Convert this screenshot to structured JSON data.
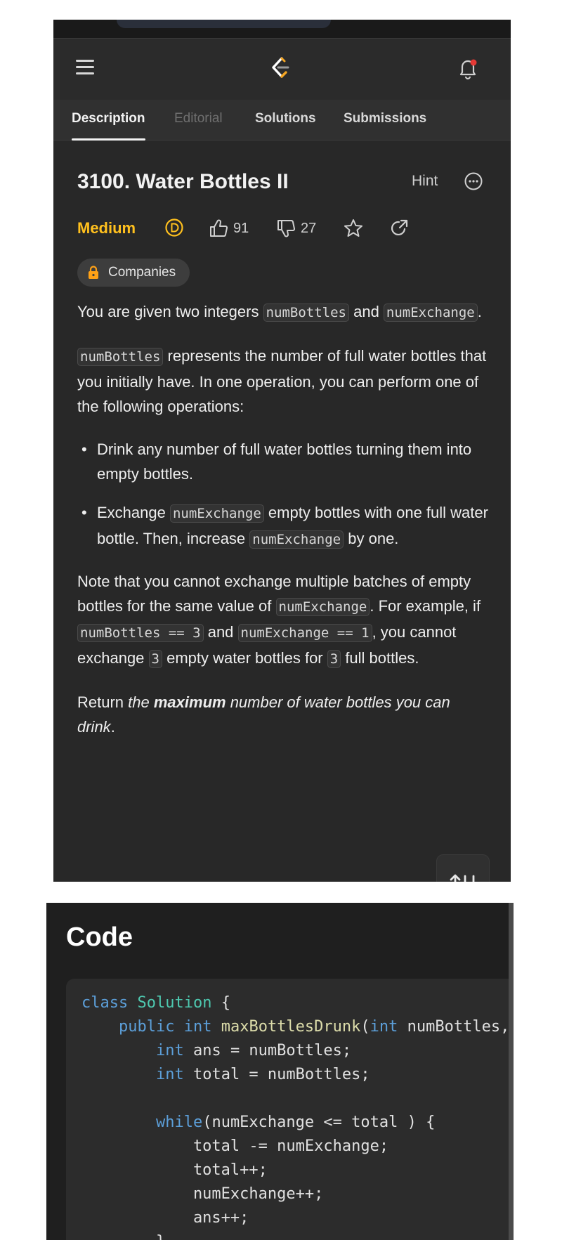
{
  "app": {
    "tabs": [
      {
        "label": "Description",
        "state": "active"
      },
      {
        "label": "Editorial",
        "state": "dim"
      },
      {
        "label": "Solutions",
        "state": "normal"
      },
      {
        "label": "Submissions",
        "state": "normal"
      }
    ]
  },
  "problem": {
    "title": "3100. Water Bottles II",
    "hint": "Hint",
    "difficulty": "Medium",
    "likes": "91",
    "dislikes": "27",
    "companies": "Companies",
    "colors": {
      "medium": "#ffc01e",
      "bell_dot": "#e53935"
    }
  },
  "desc": {
    "p1_a": "You are given two integers ",
    "p1_code1": "numBottles",
    "p1_b": " and ",
    "p1_code2": "numExchange",
    "p1_c": ".",
    "p2_code": "numBottles",
    "p2_a": " represents the number of full water bottles that you initially have. In one operation, you can perform one of the following operations:",
    "b1": "Drink any number of full water bottles turning them into empty bottles.",
    "b2_a": "Exchange ",
    "b2_code1": "numExchange",
    "b2_b": " empty bottles with one full water bottle. Then, increase ",
    "b2_code2": "numExchange",
    "b2_c": " by one.",
    "p3_a": "Note that you cannot exchange multiple batches of empty bottles for the same value of ",
    "p3_code1": "numExchange",
    "p3_b": ". For example, if ",
    "p3_code2": "numBottles == 3",
    "p3_c": " and ",
    "p3_code3": "numExchange == 1",
    "p3_d": ", you cannot exchange ",
    "p3_code4": "3",
    "p3_e": " empty water bottles for ",
    "p3_code5": "3",
    "p3_f": " full bottles.",
    "p4_a": "Return ",
    "p4_em1": "the ",
    "p4_strong": "maximum",
    "p4_em2": " number of water bottles you can drink",
    "p4_b": "."
  },
  "code": {
    "heading": "Code",
    "l1_kw": "class",
    "l1_cls": "Solution",
    "l1_rest": " {",
    "l2_indent": "    ",
    "l2_kw": "public",
    "l2_kw2": "int",
    "l2_fn": "maxBottlesDrunk",
    "l2_a": "(",
    "l2_kw3": "int",
    "l2_b": " numBottles,",
    "l3_indent": "        ",
    "l3_kw": "int",
    "l3_rest": " ans = numBottles;",
    "l4_indent": "        ",
    "l4_kw": "int",
    "l4_rest": " total = numBottles;",
    "l5": "",
    "l6_indent": "        ",
    "l6_kw": "while",
    "l6_rest": "(numExchange <= total ) {",
    "l7": "            total -= numExchange;",
    "l8": "            total++;",
    "l9": "            numExchange++;",
    "l10": "            ans++;",
    "l11": "        }"
  }
}
